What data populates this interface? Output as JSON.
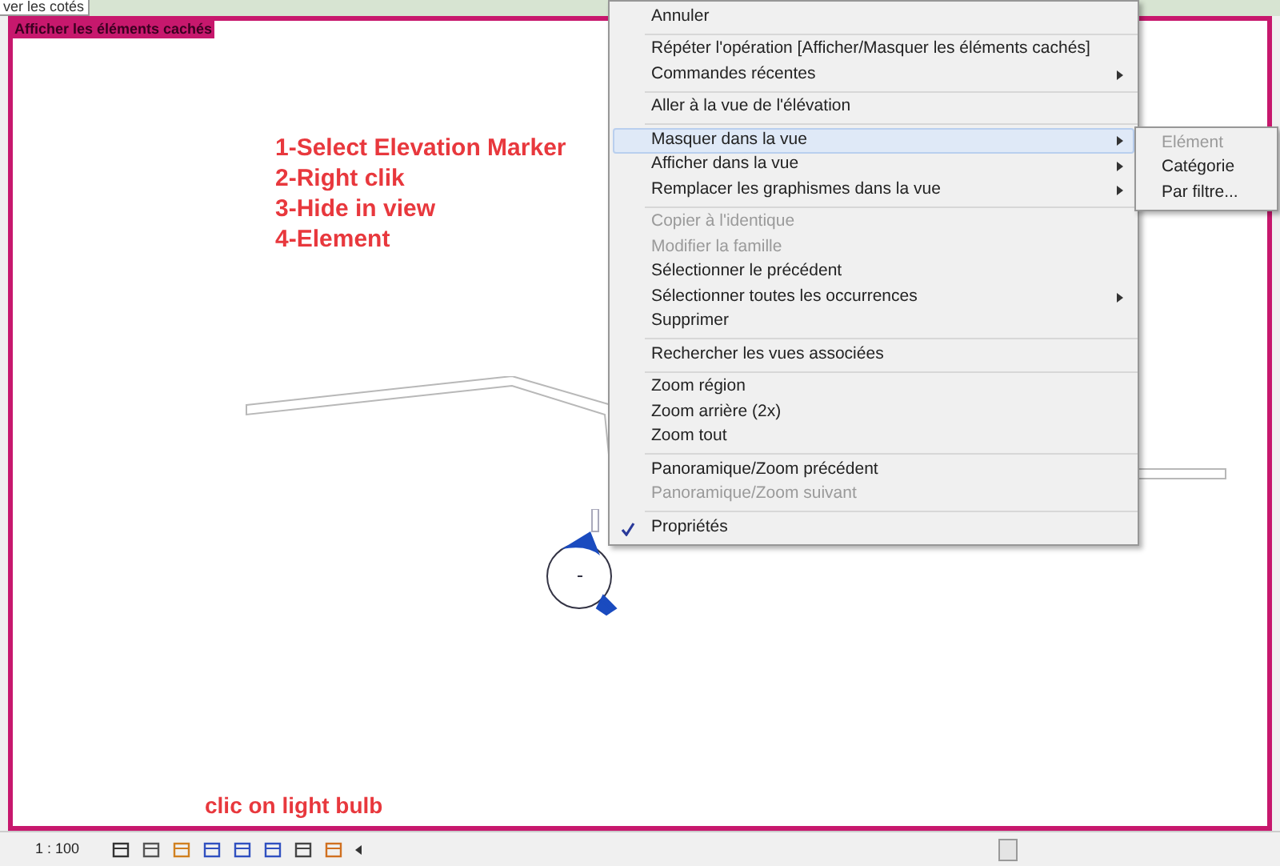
{
  "tab": {
    "label": "ver les cotés"
  },
  "view_banner": {
    "label": "Afficher les éléments cachés"
  },
  "instructions": [
    "1-Select Elevation Marker",
    "2-Right clik",
    "3-Hide in view",
    "4-Element"
  ],
  "hint": "clic on light bulb",
  "context_menu": {
    "groups": [
      [
        {
          "label": "Annuler",
          "disabled": false,
          "submenu": false,
          "selected": false,
          "checked": false
        }
      ],
      [
        {
          "label": "Répéter l'opération [Afficher/Masquer les éléments cachés]",
          "disabled": false,
          "submenu": false,
          "selected": false,
          "checked": false
        },
        {
          "label": "Commandes récentes",
          "disabled": false,
          "submenu": true,
          "selected": false,
          "checked": false
        }
      ],
      [
        {
          "label": "Aller à la vue de l'élévation",
          "disabled": false,
          "submenu": false,
          "selected": false,
          "checked": false
        }
      ],
      [
        {
          "label": "Masquer dans la vue",
          "disabled": false,
          "submenu": true,
          "selected": true,
          "checked": false
        },
        {
          "label": "Afficher dans la vue",
          "disabled": false,
          "submenu": true,
          "selected": false,
          "checked": false
        },
        {
          "label": "Remplacer les graphismes dans la vue",
          "disabled": false,
          "submenu": true,
          "selected": false,
          "checked": false
        }
      ],
      [
        {
          "label": "Copier à l'identique",
          "disabled": true,
          "submenu": false,
          "selected": false,
          "checked": false
        },
        {
          "label": "Modifier la famille",
          "disabled": true,
          "submenu": false,
          "selected": false,
          "checked": false
        },
        {
          "label": "Sélectionner le précédent",
          "disabled": false,
          "submenu": false,
          "selected": false,
          "checked": false
        },
        {
          "label": "Sélectionner toutes les occurrences",
          "disabled": false,
          "submenu": true,
          "selected": false,
          "checked": false
        },
        {
          "label": "Supprimer",
          "disabled": false,
          "submenu": false,
          "selected": false,
          "checked": false
        }
      ],
      [
        {
          "label": "Rechercher les vues associées",
          "disabled": false,
          "submenu": false,
          "selected": false,
          "checked": false
        }
      ],
      [
        {
          "label": "Zoom région",
          "disabled": false,
          "submenu": false,
          "selected": false,
          "checked": false
        },
        {
          "label": "Zoom arrière (2x)",
          "disabled": false,
          "submenu": false,
          "selected": false,
          "checked": false
        },
        {
          "label": "Zoom tout",
          "disabled": false,
          "submenu": false,
          "selected": false,
          "checked": false
        }
      ],
      [
        {
          "label": "Panoramique/Zoom précédent",
          "disabled": false,
          "submenu": false,
          "selected": false,
          "checked": false
        },
        {
          "label": "Panoramique/Zoom suivant",
          "disabled": true,
          "submenu": false,
          "selected": false,
          "checked": false
        }
      ],
      [
        {
          "label": "Propriétés",
          "disabled": false,
          "submenu": false,
          "selected": false,
          "checked": true
        }
      ]
    ]
  },
  "submenu": {
    "items": [
      {
        "label": "Elément",
        "disabled": true
      },
      {
        "label": "Catégorie",
        "disabled": false
      },
      {
        "label": "Par filtre...",
        "disabled": false
      }
    ]
  },
  "status_bar": {
    "scale": "1 : 100"
  }
}
